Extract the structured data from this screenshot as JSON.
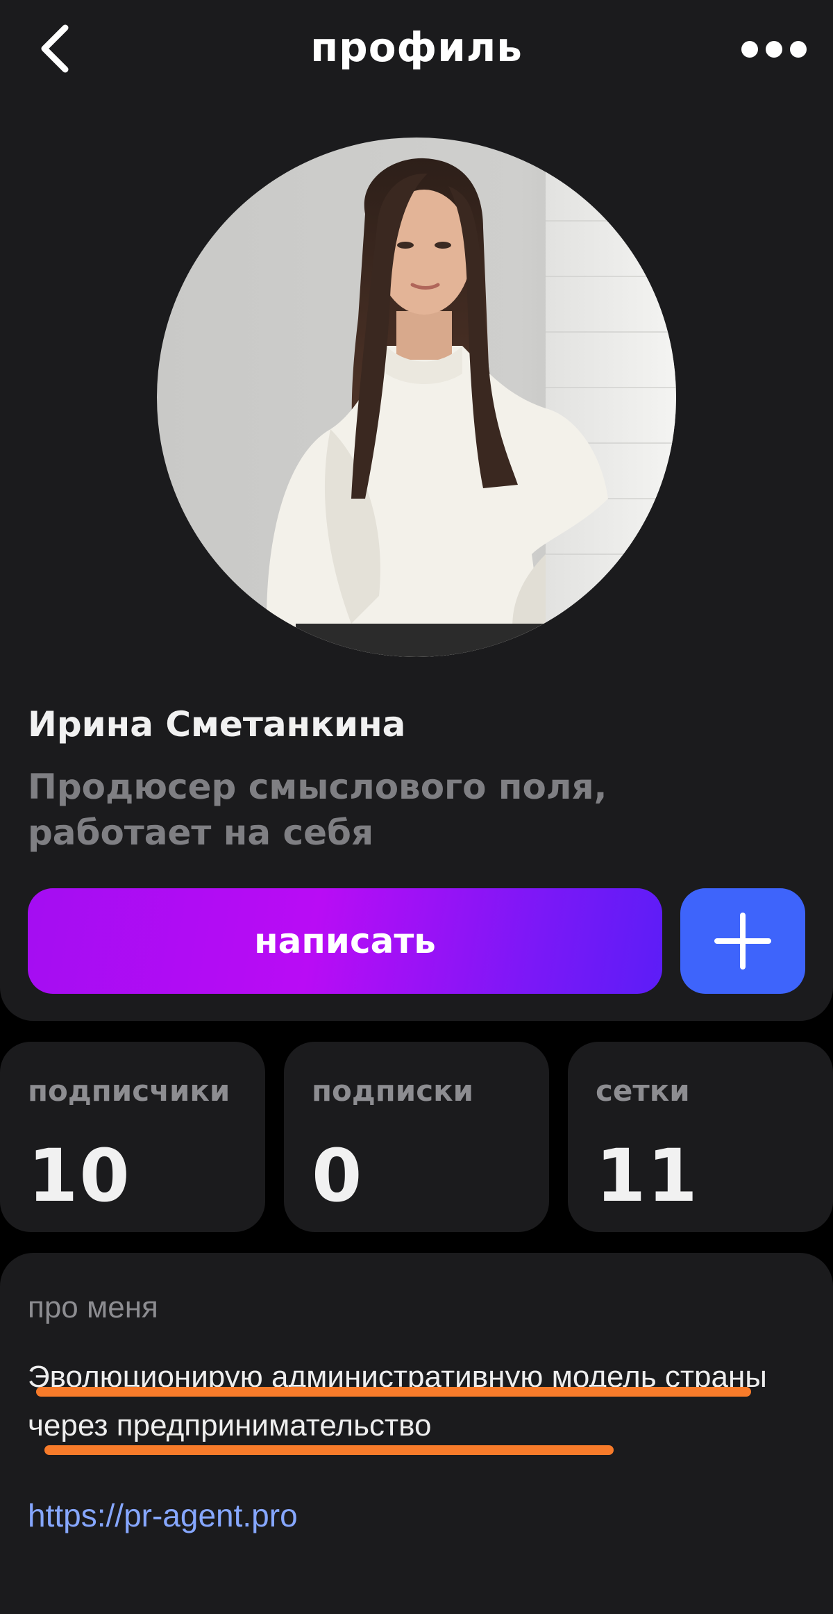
{
  "header": {
    "title": "профиль",
    "back_icon": "chevron-left-icon",
    "more_icon": "more-horizontal-icon"
  },
  "profile": {
    "name": "Ирина Сметанкина",
    "bio": "Продюсер смыслового поля, работает на себя"
  },
  "actions": {
    "write_label": "написать",
    "add_icon": "plus-icon"
  },
  "stats": [
    {
      "label": "подписчики",
      "value": "10"
    },
    {
      "label": "подписки",
      "value": "0"
    },
    {
      "label": "сетки",
      "value": "11"
    }
  ],
  "about": {
    "label": "про меня",
    "text": "Эволюционирую административную модель страны через предпринимательство",
    "link": "https://pr-agent.pro"
  },
  "colors": {
    "card_background": "#1b1b1d",
    "page_background": "#000000",
    "accent_gradient_start": "#a40df2",
    "accent_gradient_end": "#5c1df7",
    "add_button": "#3e64fb",
    "link": "#86a7ff",
    "highlight_underline": "#f77b2a"
  }
}
